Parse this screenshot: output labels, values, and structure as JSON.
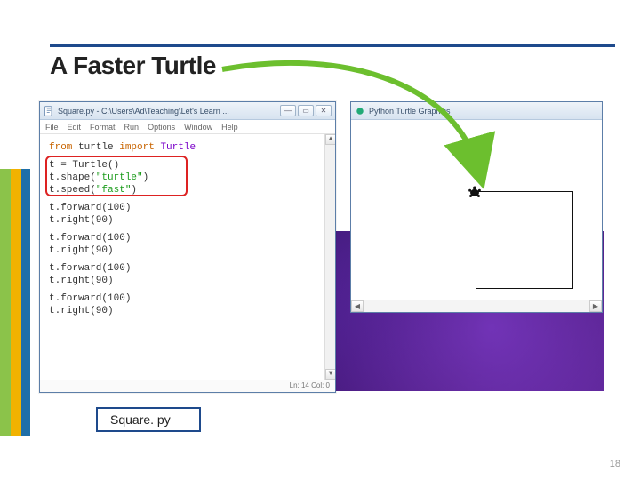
{
  "slide": {
    "title": "A Faster Turtle",
    "page_number": "18",
    "filename_chip": "Square. py"
  },
  "editor": {
    "window_title": "Square.py - C:\\Users\\Ad\\Teaching\\Let's Learn ...",
    "window_buttons": {
      "min": "—",
      "max": "▭",
      "close": "✕"
    },
    "menu": [
      "File",
      "Edit",
      "Format",
      "Run",
      "Options",
      "Window",
      "Help"
    ],
    "status": "Ln: 14  Col: 0",
    "code": {
      "line1_from": "from",
      "line1_mod": "turtle",
      "line1_import": "import",
      "line1_cls": "Turtle",
      "block_init": "t = Turtle()\nt.shape(\"turtle\")\nt.speed(\"fast\")",
      "init_l1": "t = Turtle()",
      "init_l2a": "t.shape(",
      "init_l2s": "\"turtle\"",
      "init_l2b": ")",
      "init_l3a": "t.speed(",
      "init_l3s": "\"fast\"",
      "init_l3b": ")",
      "block_move": "t.forward(100)\nt.right(90)"
    }
  },
  "turtle_window": {
    "title": "Python Turtle Graphics"
  }
}
